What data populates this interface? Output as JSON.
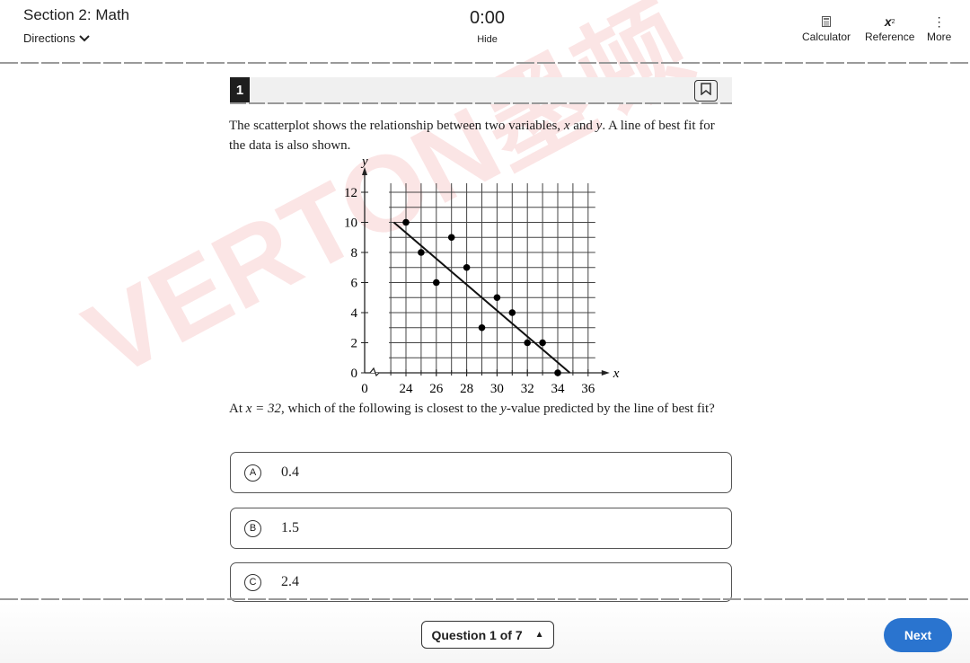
{
  "header": {
    "section": "Section 2: Math",
    "directions": "Directions",
    "timer": "0:00",
    "hide": "Hide",
    "tools": [
      {
        "label": "Calculator",
        "icon": "calculator-icon"
      },
      {
        "label": "Reference",
        "icon": "formula-icon"
      },
      {
        "label": "More",
        "icon": "more-vertical-icon"
      }
    ]
  },
  "question": {
    "number": "1",
    "text1a": "The scatterplot shows the relationship between two variables, ",
    "var_x": "x",
    "and": " and ",
    "var_y": "y",
    "text1b": ". A line of best fit for the data is also shown.",
    "text2a": "At ",
    "eq": "x = 32",
    "text2b": ", which of the following is closest to the ",
    "yvar": "y",
    "text2c": "-value predicted by the line of best fit?"
  },
  "choices": [
    {
      "letter": "A",
      "value": "0.4"
    },
    {
      "letter": "B",
      "value": "1.5"
    },
    {
      "letter": "C",
      "value": "2.4"
    }
  ],
  "footer": {
    "nav": "Question 1 of 7",
    "next": "Next"
  },
  "watermark": "VERTON墨顿",
  "colors": {
    "accent": "#2a74cf"
  },
  "chart_data": {
    "type": "scatter",
    "xlabel": "x",
    "ylabel": "y",
    "xlim": [
      23,
      36
    ],
    "ylim": [
      0,
      12
    ],
    "axis_break": true,
    "xticks": [
      "0",
      "24",
      "26",
      "28",
      "30",
      "32",
      "34",
      "36"
    ],
    "yticks": [
      "0",
      "2",
      "4",
      "6",
      "8",
      "10",
      "12"
    ],
    "grid": true,
    "points": [
      [
        24,
        10
      ],
      [
        25,
        8
      ],
      [
        26,
        6
      ],
      [
        27,
        9
      ],
      [
        28,
        7
      ],
      [
        29,
        3
      ],
      [
        30,
        5
      ],
      [
        31,
        4
      ],
      [
        32,
        2
      ],
      [
        33,
        2
      ],
      [
        34,
        0
      ]
    ],
    "fit_line": [
      [
        23.2,
        10
      ],
      [
        34.8,
        0
      ]
    ]
  }
}
